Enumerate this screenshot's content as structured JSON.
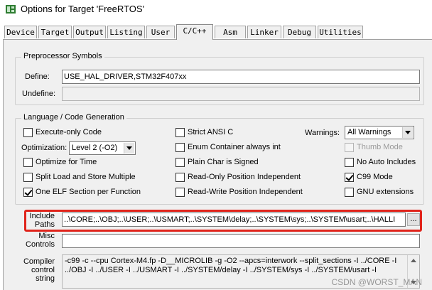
{
  "window": {
    "title": "Options for Target 'FreeRTOS'",
    "icon": "keil-app-icon"
  },
  "tabs": [
    {
      "label": "Device",
      "active": false
    },
    {
      "label": "Target",
      "active": false
    },
    {
      "label": "Output",
      "active": false
    },
    {
      "label": "Listing",
      "active": false
    },
    {
      "label": "User",
      "active": false
    },
    {
      "label": "C/C++",
      "active": true
    },
    {
      "label": "Asm",
      "active": false
    },
    {
      "label": "Linker",
      "active": false
    },
    {
      "label": "Debug",
      "active": false
    },
    {
      "label": "Utilities",
      "active": false
    }
  ],
  "preprocessor": {
    "group_title": "Preprocessor Symbols",
    "define_label": "Define:",
    "define_value": "USE_HAL_DRIVER,STM32F407xx",
    "undefine_label": "Undefine:",
    "undefine_value": ""
  },
  "language": {
    "group_title": "Language / Code Generation",
    "execute_only": {
      "label": "Execute-only Code",
      "checked": false
    },
    "optimization_label": "Optimization:",
    "optimization_value": "Level 2 (-O2)",
    "optimize_time": {
      "label": "Optimize for Time",
      "checked": false
    },
    "split_load": {
      "label": "Split Load and Store Multiple",
      "checked": false
    },
    "one_elf": {
      "label": "One ELF Section per Function",
      "checked": true
    },
    "strict_ansi": {
      "label": "Strict ANSI C",
      "checked": false
    },
    "enum_container": {
      "label": "Enum Container always int",
      "checked": false
    },
    "plain_char": {
      "label": "Plain Char is Signed",
      "checked": false
    },
    "ro_position": {
      "label": "Read-Only Position Independent",
      "checked": false
    },
    "rw_position": {
      "label": "Read-Write Position Independent",
      "checked": false
    },
    "warnings_label": "Warnings:",
    "warnings_value": "All Warnings",
    "thumb_mode": {
      "label": "Thumb Mode",
      "checked": false,
      "disabled": true
    },
    "no_auto_includes": {
      "label": "No Auto Includes",
      "checked": false
    },
    "c99_mode": {
      "label": "C99 Mode",
      "checked": true
    },
    "gnu_extensions": {
      "label": "GNU extensions",
      "checked": false
    }
  },
  "include_paths": {
    "label_line1": "Include",
    "label_line2": "Paths",
    "value": "..\\CORE;..\\OBJ;..\\USER;..\\USMART;..\\SYSTEM\\delay;..\\SYSTEM\\sys;..\\SYSTEM\\usart;..\\HALLI",
    "browse_label": "..."
  },
  "misc_controls": {
    "label_line1": "Misc",
    "label_line2": "Controls",
    "value": ""
  },
  "compiler_string": {
    "label_line1": "Compiler",
    "label_line2": "control",
    "label_line3": "string",
    "value": "-c99 -c --cpu Cortex-M4.fp -D__MICROLIB -g -O2 --apcs=interwork --split_sections -I ../CORE -I ../OBJ -I ../USER -I ../USMART -I ../SYSTEM/delay -I ../SYSTEM/sys -I ../SYSTEM/usart -I"
  },
  "watermark": "CSDN @WORST_MAN",
  "colors": {
    "highlight": "#e0241b",
    "panel": "#f0f0f0"
  }
}
